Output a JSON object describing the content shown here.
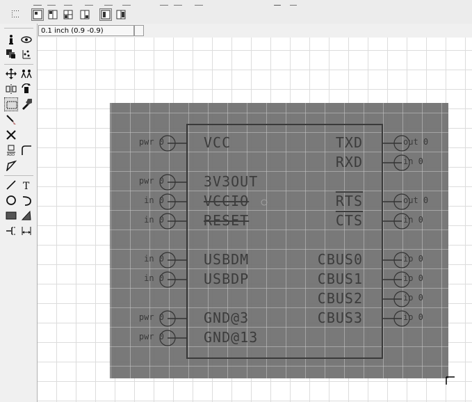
{
  "toolbar": {
    "top_icons": [
      "new-icon",
      "open-icon",
      "save-icon",
      "print-icon",
      "undo-icon",
      "redo-icon",
      "cut-icon",
      "copy-icon",
      "paste-icon",
      "zoom-in-icon",
      "zoom-out-icon",
      "stop-icon",
      "run-icon"
    ],
    "layout_buttons": [
      {
        "name": "grid-toggle-icon",
        "active": false
      },
      {
        "name": "layout-single-icon",
        "active": true
      },
      {
        "name": "layout-split-icon",
        "active": false
      },
      {
        "name": "layout-quad-icon",
        "active": false
      },
      {
        "name": "layout-corner-icon",
        "active": false
      },
      {
        "name": "layout-left-icon",
        "active": true
      },
      {
        "name": "layout-right-icon",
        "active": false
      }
    ]
  },
  "coordinate": {
    "display": "0.1 inch (0.9 -0.9)"
  },
  "tools": [
    {
      "name": "info-icon"
    },
    {
      "name": "eye-icon"
    },
    {
      "name": "layer-display-icon"
    },
    {
      "name": "mark-icon"
    },
    {
      "name": "move-icon"
    },
    {
      "name": "copy-group-icon"
    },
    {
      "name": "mirror-icon"
    },
    {
      "name": "rotate-icon"
    },
    {
      "name": "group-select-icon",
      "active": true
    },
    {
      "name": "change-icon"
    },
    {
      "name": "paint-icon"
    },
    {
      "name": "delete-icon"
    },
    {
      "name": "add-part-icon"
    },
    {
      "name": "miter-icon"
    },
    {
      "name": "split-icon"
    },
    {
      "name": "line-tool-icon"
    },
    {
      "name": "text-tool-icon"
    },
    {
      "name": "circle-tool-icon"
    },
    {
      "name": "arc-tool-icon"
    },
    {
      "name": "rectangle-tool-icon"
    },
    {
      "name": "polygon-tool-icon"
    },
    {
      "name": "pin-tool-icon"
    },
    {
      "name": "dimension-tool-icon"
    }
  ],
  "symbol": {
    "left_pins": [
      {
        "dir": "pwr",
        "num": "0",
        "name": "VCC"
      },
      {
        "dir": "pwr",
        "num": "0",
        "name": "3V3OUT"
      },
      {
        "dir": "in",
        "num": "0",
        "name": "VCCIO"
      },
      {
        "dir": "in",
        "num": "0",
        "name": "RESET"
      },
      {
        "dir": "in",
        "num": "0",
        "name": "USBDM"
      },
      {
        "dir": "in",
        "num": "0",
        "name": "USBDP"
      },
      {
        "dir": "pwr",
        "num": "0",
        "name": "GND@3"
      },
      {
        "dir": "pwr",
        "num": "0",
        "name": "GND@13"
      }
    ],
    "right_pins": [
      {
        "dir": "out",
        "num": "0",
        "name": "TXD"
      },
      {
        "dir": "in",
        "num": "0",
        "name": "RXD"
      },
      {
        "dir": "out",
        "num": "0",
        "name": "RTS"
      },
      {
        "dir": "in",
        "num": "0",
        "name": "CTS"
      },
      {
        "dir": "io",
        "num": "0",
        "name": "CBUS0"
      },
      {
        "dir": "io",
        "num": "0",
        "name": "CBUS1"
      },
      {
        "dir": "io",
        "num": "0",
        "name": "CBUS2"
      },
      {
        "dir": "io",
        "num": "0",
        "name": "CBUS3"
      }
    ]
  }
}
